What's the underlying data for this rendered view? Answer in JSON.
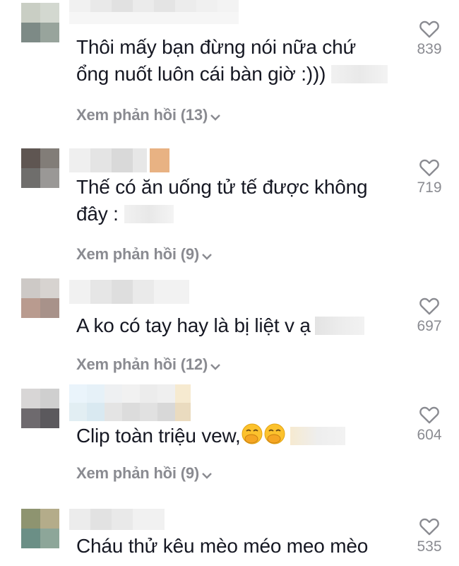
{
  "comments": [
    {
      "text": "Thôi mấy bạn đừng nói nữa chứ\nổng nuốt luôn cái bàn giờ :)))",
      "reply_label": "Xem phản hồi (13)",
      "likes": "839"
    },
    {
      "text": "Thế có ăn uống tử tế được không\nđây :",
      "reply_label": "Xem phản hồi (9)",
      "likes": "719"
    },
    {
      "text": "A ko có tay hay là bị liệt v ạ",
      "reply_label": "Xem phản hồi (12)",
      "likes": "697"
    },
    {
      "text": "Clip toàn triệu vew,",
      "reply_label": "Xem phản hồi (9)",
      "likes": "604"
    },
    {
      "text": "Cháu thử kêu mèo méo meo mèo",
      "reply_label": "",
      "likes": "535"
    }
  ],
  "icons": {
    "like": "heart-outline-icon",
    "expand": "chevron-down-icon",
    "emoji": "hand-over-mouth-emoji"
  },
  "colors": {
    "text": "#161823",
    "muted": "#8a8b91"
  }
}
